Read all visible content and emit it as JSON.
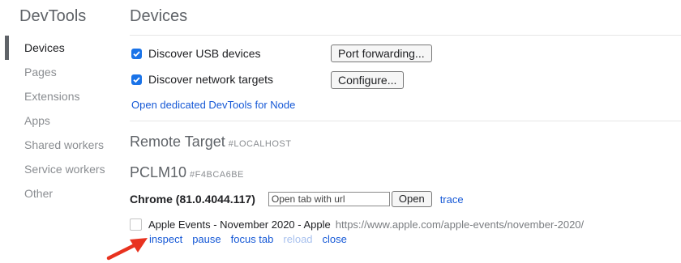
{
  "sidebar": {
    "title": "DevTools",
    "items": [
      {
        "label": "Devices"
      },
      {
        "label": "Pages"
      },
      {
        "label": "Extensions"
      },
      {
        "label": "Apps"
      },
      {
        "label": "Shared workers"
      },
      {
        "label": "Service workers"
      },
      {
        "label": "Other"
      }
    ]
  },
  "main": {
    "title": "Devices",
    "discover_usb": {
      "label": "Discover USB devices",
      "checked": true
    },
    "discover_network": {
      "label": "Discover network targets",
      "checked": true
    },
    "port_forwarding_button": "Port forwarding...",
    "configure_button": "Configure...",
    "node_link": "Open dedicated DevTools for Node",
    "remote_target": {
      "title": "Remote Target",
      "subtitle": "#LOCALHOST"
    },
    "device": {
      "title": "PCLM10",
      "subtitle": "#F4BCA6BE"
    },
    "browser": {
      "name": "Chrome (81.0.4044.117)",
      "url_placeholder": "Open tab with url",
      "open_button": "Open",
      "trace_link": "trace"
    },
    "target": {
      "title": "Apple Events - November 2020 - Apple",
      "url": "https://www.apple.com/apple-events/november-2020/",
      "actions": {
        "inspect": "inspect",
        "pause": "pause",
        "focus_tab": "focus tab",
        "reload": "reload",
        "close": "close"
      }
    }
  },
  "colors": {
    "accent": "#1a73e8",
    "link": "#1558d6",
    "arrow": "#e8321f"
  }
}
